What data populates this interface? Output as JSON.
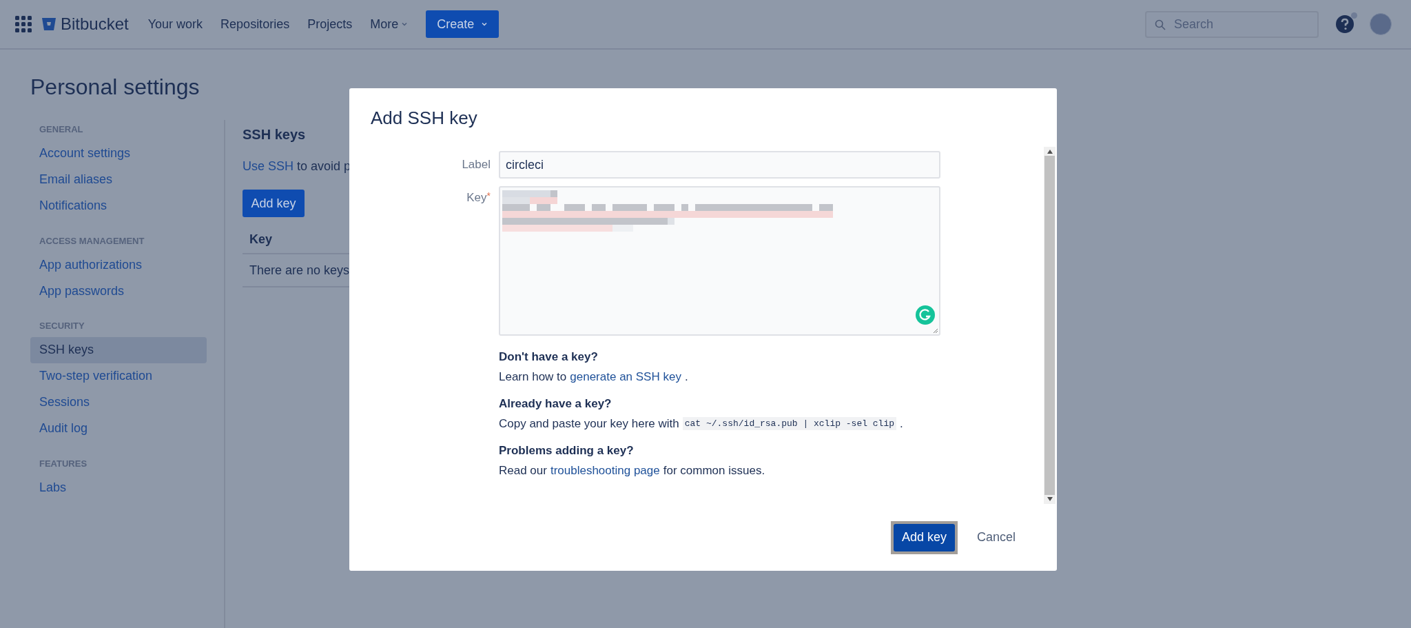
{
  "nav": {
    "brand": "Bitbucket",
    "items": [
      {
        "label": "Your work",
        "has_caret": false
      },
      {
        "label": "Repositories",
        "has_caret": false
      },
      {
        "label": "Projects",
        "has_caret": false
      },
      {
        "label": "More",
        "has_caret": true
      }
    ],
    "create": "Create",
    "search": {
      "placeholder": "Search"
    }
  },
  "page_title": "Personal settings",
  "sidebar": {
    "sections": [
      {
        "heading": "GENERAL",
        "items": [
          {
            "label": "Account settings",
            "selected": false
          },
          {
            "label": "Email aliases",
            "selected": false
          },
          {
            "label": "Notifications",
            "selected": false
          }
        ]
      },
      {
        "heading": "ACCESS MANAGEMENT",
        "items": [
          {
            "label": "App authorizations",
            "selected": false
          },
          {
            "label": "App passwords",
            "selected": false
          }
        ]
      },
      {
        "heading": "SECURITY",
        "items": [
          {
            "label": "SSH keys",
            "selected": true
          },
          {
            "label": "Two-step verification",
            "selected": false
          },
          {
            "label": "Sessions",
            "selected": false
          },
          {
            "label": "Audit log",
            "selected": false
          }
        ]
      },
      {
        "heading": "FEATURES",
        "items": [
          {
            "label": "Labs",
            "selected": false
          }
        ]
      }
    ]
  },
  "content": {
    "title": "SSH keys",
    "intro_link": "Use SSH",
    "intro_text": "to avoid p",
    "add_button": "Add key",
    "table": {
      "columns": [
        "Key"
      ],
      "empty": "There are no keys"
    }
  },
  "modal": {
    "title": "Add SSH key",
    "label_field": {
      "label": "Label",
      "value": "circleci"
    },
    "key_field": {
      "label": "Key",
      "required_mark": "*"
    },
    "help": [
      {
        "heading": "Don't have a key?",
        "parts": [
          {
            "kind": "text",
            "text": "Learn how to"
          },
          {
            "kind": "link",
            "text": "generate an SSH key"
          },
          {
            "kind": "text",
            "text": "."
          }
        ]
      },
      {
        "heading": "Already have a key?",
        "parts": [
          {
            "kind": "text",
            "text": "Copy and paste your key here with"
          },
          {
            "kind": "code",
            "text": "cat ~/.ssh/id_rsa.pub | xclip -sel clip"
          },
          {
            "kind": "text",
            "text": "."
          }
        ]
      },
      {
        "heading": "Problems adding a key?",
        "parts": [
          {
            "kind": "text",
            "text": "Read our"
          },
          {
            "kind": "link",
            "text": "troubleshooting page"
          },
          {
            "kind": "text",
            "text": "for common issues."
          }
        ]
      }
    ],
    "submit": "Add key",
    "cancel": "Cancel"
  }
}
